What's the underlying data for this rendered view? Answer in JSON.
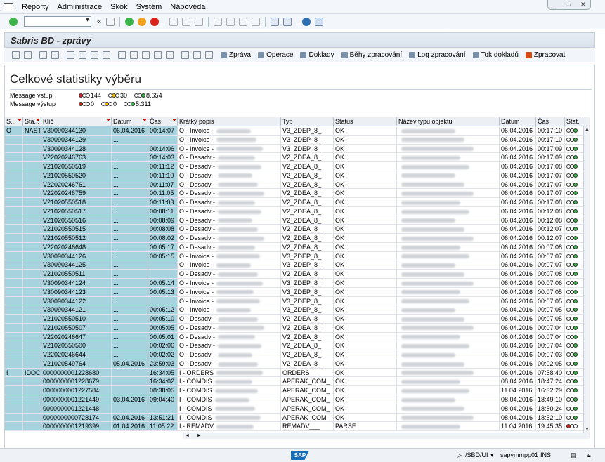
{
  "menu": {
    "items": [
      "Reporty",
      "Administrace",
      "Skok",
      "Systém",
      "Nápověda"
    ]
  },
  "page_title": "Sabris BD - zprávy",
  "app_toolbar": {
    "buttons": [
      "Zpráva",
      "Operace",
      "Doklady",
      "Běhy zpracování",
      "Log zpracování",
      "Tok dokladů",
      "Zpracovat"
    ]
  },
  "stats": {
    "title": "Celkové statistiky výběru",
    "rows": [
      {
        "label": "Message vstup",
        "red": "144",
        "yellow": "30",
        "green": "8.654"
      },
      {
        "label": "Message výstup",
        "red": "0",
        "yellow": "0",
        "green": "5.311"
      }
    ]
  },
  "grid": {
    "headers": [
      "S...",
      "Sta...",
      "Klíč",
      "Datum",
      "Čas",
      "Krátký popis",
      "Typ",
      "Status",
      "Název typu objektu",
      "Datum",
      "Čas",
      "Stat..."
    ],
    "rows": [
      [
        "O",
        "NAST",
        "V30090344130",
        "06.04.2016",
        "00:14:07",
        "O - Invoice -",
        "V3_ZDEP_8_",
        "OK",
        "",
        "06.04.2016",
        "00:17:10"
      ],
      [
        "",
        "",
        "V30090344129",
        "...",
        "",
        "O - Invoice -",
        "V3_ZDEP_8_",
        "OK",
        "",
        "06.04.2016",
        "00:17:10"
      ],
      [
        "",
        "",
        "V30090344128",
        "",
        "00:14:06",
        "O - Invoice -",
        "V3_ZDEP_8_",
        "OK",
        "",
        "06.04.2016",
        "00:17:09"
      ],
      [
        "",
        "",
        "V22020246763",
        "...",
        "00:14:03",
        "O - Desadv -",
        "V2_ZDEA_8_",
        "OK",
        "",
        "06.04.2016",
        "00:17:09"
      ],
      [
        "",
        "",
        "V21020550519",
        "...",
        "00:11:12",
        "O - Desadv -",
        "V2_ZDEA_8_",
        "OK",
        "",
        "06.04.2016",
        "00:17:08"
      ],
      [
        "",
        "",
        "V21020550520",
        "...",
        "00:11:10",
        "O - Desadv -",
        "V2_ZDEA_8_",
        "OK",
        "",
        "06.04.2016",
        "00:17:07"
      ],
      [
        "",
        "",
        "V22020246761",
        "...",
        "00:11:07",
        "O - Desadv -",
        "V2_ZDEA_8_",
        "OK",
        "",
        "06.04.2016",
        "00:17:07"
      ],
      [
        "",
        "",
        "V22020246759",
        "...",
        "00:11:05",
        "O - Desadv -",
        "V2_ZDEA_8_",
        "OK",
        "",
        "06.04.2016",
        "00:17:07"
      ],
      [
        "",
        "",
        "V21020550518",
        "...",
        "00:11:03",
        "O - Desadv -",
        "V2_ZDEA_8_",
        "OK",
        "",
        "06.04.2016",
        "00:17:08"
      ],
      [
        "",
        "",
        "V21020550517",
        "...",
        "00:08:11",
        "O - Desadv -",
        "V2_ZDEA_8_",
        "OK",
        "",
        "06.04.2016",
        "00:12:08"
      ],
      [
        "",
        "",
        "V21020550516",
        "...",
        "00:08:09",
        "O - Desadv -",
        "V2_ZDEA_8_",
        "OK",
        "",
        "06.04.2016",
        "00:12:08"
      ],
      [
        "",
        "",
        "V21020550515",
        "...",
        "00:08:08",
        "O - Desadv -",
        "V2_ZDEA_8_",
        "OK",
        "",
        "06.04.2016",
        "00:12:07"
      ],
      [
        "",
        "",
        "V21020550512",
        "...",
        "00:08:02",
        "O - Desadv -",
        "V2_ZDEA_8_",
        "OK",
        "",
        "06.04.2016",
        "00:12:07"
      ],
      [
        "",
        "",
        "V22020246648",
        "...",
        "00:05:17",
        "O - Desadv -",
        "V2_ZDEA_8_",
        "OK",
        "",
        "06.04.2016",
        "00:07:08"
      ],
      [
        "",
        "",
        "V30090344126",
        "...",
        "00:05:15",
        "O - Invoice -",
        "V3_ZDEP_8_",
        "OK",
        "",
        "06.04.2016",
        "00:07:07"
      ],
      [
        "",
        "",
        "V30090344125",
        "...",
        "",
        "O - Invoice -",
        "V3_ZDEP_8_",
        "OK",
        "",
        "06.04.2016",
        "00:07:07"
      ],
      [
        "",
        "",
        "V21020550511",
        "...",
        "",
        "O - Desadv -",
        "V2_ZDEA_8_",
        "OK",
        "",
        "06.04.2016",
        "00:07:08"
      ],
      [
        "",
        "",
        "V30090344124",
        "...",
        "00:05:14",
        "O - Invoice -",
        "V3_ZDEP_8_",
        "OK",
        "",
        "06.04.2016",
        "00:07:06"
      ],
      [
        "",
        "",
        "V30090344123",
        "...",
        "00:05:13",
        "O - Invoice -",
        "V3_ZDEP_8_",
        "OK",
        "",
        "06.04.2016",
        "00:07:05"
      ],
      [
        "",
        "",
        "V30090344122",
        "...",
        "",
        "O - Invoice -",
        "V3_ZDEP_8_",
        "OK",
        "",
        "06.04.2016",
        "00:07:05"
      ],
      [
        "",
        "",
        "V30090344121",
        "...",
        "00:05:12",
        "O - Invoice -",
        "V3_ZDEP_8_",
        "OK",
        "",
        "06.04.2016",
        "00:07:05"
      ],
      [
        "",
        "",
        "V21020550510",
        "...",
        "00:05:10",
        "O - Desadv -",
        "V2_ZDEA_8_",
        "OK",
        "",
        "06.04.2016",
        "00:07:05"
      ],
      [
        "",
        "",
        "V21020550507",
        "...",
        "00:05:05",
        "O - Desadv -",
        "V2_ZDEA_8_",
        "OK",
        "",
        "06.04.2016",
        "00:07:04"
      ],
      [
        "",
        "",
        "V22020246647",
        "...",
        "00:05:01",
        "O - Desadv -",
        "V2_ZDEA_8_",
        "OK",
        "",
        "06.04.2016",
        "00:07:04"
      ],
      [
        "",
        "",
        "V21020550500",
        "...",
        "00:02:06",
        "O - Desadv -",
        "V2_ZDEA_8_",
        "OK",
        "",
        "06.04.2016",
        "00:07:04"
      ],
      [
        "",
        "",
        "V22020246644",
        "...",
        "00:02:02",
        "O - Desadv -",
        "V2_ZDEA_8_",
        "OK",
        "",
        "06.04.2016",
        "00:07:03"
      ],
      [
        "",
        "",
        "V21020549764",
        "05.04.2016",
        "23:59:03",
        "O - Desadv -",
        "V2_ZDEA_8_",
        "OK",
        "",
        "06.04.2016",
        "00:02:05"
      ],
      [
        "I",
        "IDOC",
        "0000000001228680",
        "",
        "16:34:05",
        "I - ORDERS",
        "ORDERS___",
        "OK",
        "",
        "06.04.2016",
        "07:58:40"
      ],
      [
        "",
        "",
        "0000000001228679",
        "",
        "16:34:02",
        "I - COMDIS",
        "APERAK_COM_",
        "OK",
        "",
        "08.04.2016",
        "18:47:24"
      ],
      [
        "",
        "",
        "0000000001227584",
        "",
        "08:38:05",
        "I - COMDIS",
        "APERAK_COM_",
        "OK",
        "",
        "11.04.2016",
        "16:32:29"
      ],
      [
        "",
        "",
        "0000000001221449",
        "03.04.2016",
        "09:04:40",
        "I - COMDIS",
        "APERAK_COM_",
        "OK",
        "",
        "08.04.2016",
        "18:49:10"
      ],
      [
        "",
        "",
        "0000000001221448",
        "",
        "",
        "I - COMDIS",
        "APERAK_COM_",
        "OK",
        "",
        "08.04.2016",
        "18:50:24"
      ],
      [
        "",
        "",
        "0000000000728174",
        "02.04.2016",
        "13:51:21",
        "I - COMDIS",
        "APERAK_COM_",
        "OK",
        "",
        "08.04.2016",
        "18:52:10"
      ],
      [
        "",
        "",
        "0000000001219399",
        "01.04.2016",
        "11:05:22",
        "I - REMADV",
        "REMADV___",
        "PARSE",
        "",
        "11.04.2016",
        "19:45:35"
      ]
    ]
  },
  "statusbar": {
    "system": "/SBD/UI",
    "server": "sapvmmpp01",
    "mode": "INS"
  },
  "colors": {
    "key_cell": "#a7d3df",
    "lamp_green": "#3bb54a",
    "lamp_yellow": "#f2c200",
    "lamp_red": "#d9231a"
  }
}
